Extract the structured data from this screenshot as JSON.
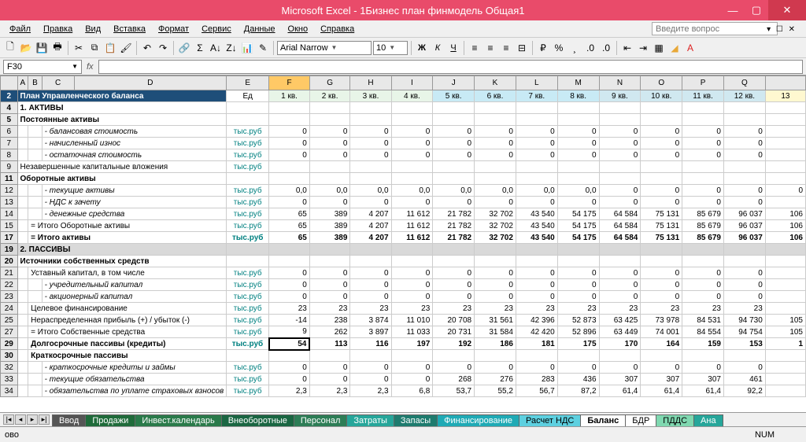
{
  "app": {
    "title": "Microsoft Excel - 1Бизнес план финмодель Общая1"
  },
  "menu": [
    "Файл",
    "Правка",
    "Вид",
    "Вставка",
    "Формат",
    "Сервис",
    "Данные",
    "Окно",
    "Справка"
  ],
  "askbox": "Введите вопрос",
  "font": {
    "name": "Arial Narrow",
    "size": "10"
  },
  "namebox": "F30",
  "columns": [
    "",
    "A",
    "B",
    "C",
    "D",
    "E",
    "F",
    "G",
    "H",
    "I",
    "J",
    "K",
    "L",
    "M",
    "N",
    "O",
    "P",
    "Q",
    ""
  ],
  "header": {
    "title": "План Управленческого баланса",
    "unit": "Ед",
    "quarters": [
      "1 кв.",
      "2 кв.",
      "3 кв.",
      "4 кв.",
      "5 кв.",
      "6 кв.",
      "7 кв.",
      "8 кв.",
      "9 кв.",
      "10 кв.",
      "11 кв.",
      "12 кв.",
      "13"
    ]
  },
  "unit": "тыс.руб",
  "rows": [
    {
      "n": "2",
      "type": "hdr"
    },
    {
      "n": "4",
      "type": "section-bold",
      "label": "1. АКТИВЫ"
    },
    {
      "n": "5",
      "type": "section-bold",
      "label": "Постоянные активы"
    },
    {
      "n": "6",
      "type": "data",
      "label": " - балансовая стоимость",
      "em": true,
      "vals": [
        "0",
        "0",
        "0",
        "0",
        "0",
        "0",
        "0",
        "0",
        "0",
        "0",
        "0",
        "0",
        ""
      ]
    },
    {
      "n": "7",
      "type": "data",
      "label": " - начисленный износ",
      "em": true,
      "vals": [
        "0",
        "0",
        "0",
        "0",
        "0",
        "0",
        "0",
        "0",
        "0",
        "0",
        "0",
        "0",
        ""
      ]
    },
    {
      "n": "8",
      "type": "data",
      "label": " - остаточная стоимость",
      "em": true,
      "vals": [
        "0",
        "0",
        "0",
        "0",
        "0",
        "0",
        "0",
        "0",
        "0",
        "0",
        "0",
        "0",
        ""
      ]
    },
    {
      "n": "9",
      "type": "plain",
      "label": "Незавершенные капитальные вложения",
      "vals": [
        "",
        "",
        "",
        "",
        "",
        "",
        "",
        "",
        "",
        "",
        "",
        "",
        ""
      ]
    },
    {
      "n": "11",
      "type": "section-bold",
      "label": "Оборотные активы"
    },
    {
      "n": "12",
      "type": "data",
      "label": " - текущие активы",
      "em": true,
      "vals": [
        "0,0",
        "0,0",
        "0,0",
        "0,0",
        "0,0",
        "0,0",
        "0,0",
        "0,0",
        "0",
        "0",
        "0",
        "0",
        "0"
      ]
    },
    {
      "n": "13",
      "type": "data",
      "label": " - НДС к зачету",
      "em": true,
      "vals": [
        "0",
        "0",
        "0",
        "0",
        "0",
        "0",
        "0",
        "0",
        "0",
        "0",
        "0",
        "0",
        ""
      ]
    },
    {
      "n": "14",
      "type": "data",
      "label": " - денежные средства",
      "em": true,
      "vals": [
        "65",
        "389",
        "4 207",
        "11 612",
        "21 782",
        "32 702",
        "43 540",
        "54 175",
        "64 584",
        "75 131",
        "85 679",
        "96 037",
        "106"
      ]
    },
    {
      "n": "15",
      "type": "plain",
      "label": "= Итого Оборотные активы",
      "indent": 1,
      "vals": [
        "65",
        "389",
        "4 207",
        "11 612",
        "21 782",
        "32 702",
        "43 540",
        "54 175",
        "64 584",
        "75 131",
        "85 679",
        "96 037",
        "106"
      ]
    },
    {
      "n": "17",
      "type": "bold",
      "label": "= Итого активы",
      "indent": 1,
      "vals": [
        "65",
        "389",
        "4 207",
        "11 612",
        "21 782",
        "32 702",
        "43 540",
        "54 175",
        "64 584",
        "75 131",
        "85 679",
        "96 037",
        "106"
      ]
    },
    {
      "n": "19",
      "type": "section",
      "label": "2. ПАССИВЫ"
    },
    {
      "n": "20",
      "type": "section-bold",
      "label": "Источники собственных средств"
    },
    {
      "n": "21",
      "type": "plain",
      "label": "Уставный капитал, в том числе",
      "indent": 1,
      "vals": [
        "0",
        "0",
        "0",
        "0",
        "0",
        "0",
        "0",
        "0",
        "0",
        "0",
        "0",
        "0",
        ""
      ]
    },
    {
      "n": "22",
      "type": "data",
      "label": " - учредительный капитал",
      "em": true,
      "vals": [
        "0",
        "0",
        "0",
        "0",
        "0",
        "0",
        "0",
        "0",
        "0",
        "0",
        "0",
        "0",
        ""
      ]
    },
    {
      "n": "23",
      "type": "data",
      "label": " - акционерный капитал",
      "em": true,
      "vals": [
        "0",
        "0",
        "0",
        "0",
        "0",
        "0",
        "0",
        "0",
        "0",
        "0",
        "0",
        "0",
        ""
      ]
    },
    {
      "n": "24",
      "type": "plain",
      "label": "Целевое финансирование",
      "indent": 1,
      "vals": [
        "23",
        "23",
        "23",
        "23",
        "23",
        "23",
        "23",
        "23",
        "23",
        "23",
        "23",
        "23",
        ""
      ]
    },
    {
      "n": "25",
      "type": "plain",
      "label": "Нераспределенная прибыль (+) / убыток (-)",
      "indent": 1,
      "vals": [
        "-14",
        "238",
        "3 874",
        "11 010",
        "20 708",
        "31 561",
        "42 396",
        "52 873",
        "63 425",
        "73 978",
        "84 531",
        "94 730",
        "105"
      ]
    },
    {
      "n": "27",
      "type": "plain",
      "label": "= Итого Собственные средства",
      "indent": 1,
      "vals": [
        "9",
        "262",
        "3 897",
        "11 033",
        "20 731",
        "31 584",
        "42 420",
        "52 896",
        "63 449",
        "74 001",
        "84 554",
        "94 754",
        "105"
      ]
    },
    {
      "n": "29",
      "type": "bold",
      "label": "Долгосрочные пассивы (кредиты)",
      "indent": 1,
      "vals": [
        "54",
        "113",
        "116",
        "197",
        "192",
        "186",
        "181",
        "175",
        "170",
        "164",
        "159",
        "153",
        "1"
      ]
    },
    {
      "n": "30",
      "type": "section-bold",
      "label": "Краткосрочные пассивы",
      "indent": 1
    },
    {
      "n": "32",
      "type": "data",
      "label": " - краткосрочные кредиты и займы",
      "em": true,
      "vals": [
        "0",
        "0",
        "0",
        "0",
        "0",
        "0",
        "0",
        "0",
        "0",
        "0",
        "0",
        "0",
        ""
      ]
    },
    {
      "n": "33",
      "type": "data",
      "label": " - текущие обязательства",
      "em": true,
      "vals": [
        "0",
        "0",
        "0",
        "0",
        "268",
        "276",
        "283",
        "436",
        "307",
        "307",
        "307",
        "461",
        ""
      ]
    },
    {
      "n": "34",
      "type": "data",
      "label": " - обязательства по уплате страховых взносов",
      "em": true,
      "vals": [
        "2,3",
        "2,3",
        "2,3",
        "6,8",
        "53,7",
        "55,2",
        "56,7",
        "87,2",
        "61,4",
        "61,4",
        "61,4",
        "92,2",
        ""
      ]
    }
  ],
  "tabs": [
    "Ввод",
    "Продажи",
    "Инвест.календарь",
    "Внеоборотные",
    "Персонал",
    "Затраты",
    "Запасы",
    "Финансирование",
    "Расчет НДС",
    "Баланс",
    "БДР",
    "ПДДС",
    "Ана"
  ],
  "status": {
    "ready": "ово",
    "num": "NUM"
  }
}
